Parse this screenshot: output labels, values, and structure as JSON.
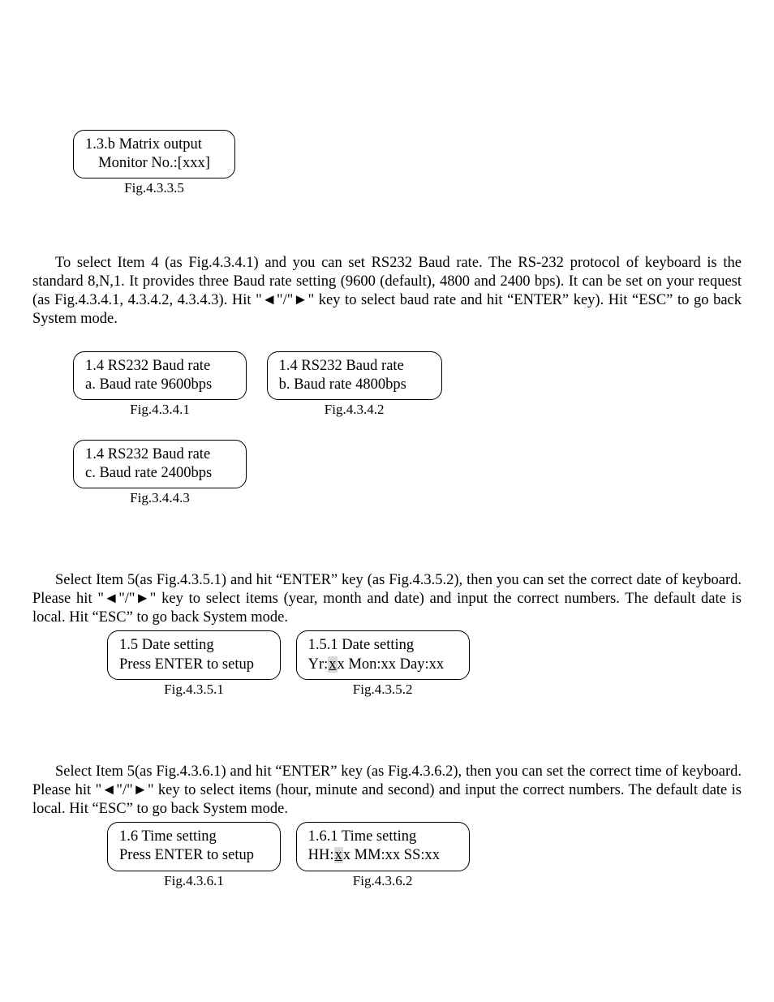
{
  "fig1": {
    "line1": "1.3.b Matrix output",
    "line2": "Monitor No.:[xxx]",
    "caption": "Fig.4.3.3.5"
  },
  "para1": {
    "text_a": "To select Item 4 (as Fig.4.3.4.1) and you can set RS232 Baud rate. The RS-232 protocol of keyboard is the standard 8,N,1. It provides three Baud rate setting (9600 (default), 4800 and 2400 bps). It can be set on your request (as Fig.4.3.4.1, 4.3.4.2, 4.3.4.3). Hit \"◄\"/\"►\" key to select baud rate and hit “ENTER” key). Hit “ESC” to go back System mode."
  },
  "baud": {
    "a": {
      "line1": "1.4 RS232 Baud rate",
      "line2": "a. Baud rate 9600bps",
      "caption": "Fig.4.3.4.1"
    },
    "b": {
      "line1": "1.4 RS232 Baud rate",
      "line2": "b. Baud rate 4800bps",
      "caption": "Fig.4.3.4.2"
    },
    "c": {
      "line1": "1.4 RS232 Baud rate",
      "line2": "c. Baud rate 2400bps",
      "caption": "Fig.3.4.4.3"
    }
  },
  "para2": {
    "text": "Select Item 5(as Fig.4.3.5.1) and hit “ENTER” key (as Fig.4.3.5.2), then you can set the correct date of keyboard. Please hit \"◄\"/\"►\" key to select items (year, month and date) and input the correct numbers. The default date is local. Hit “ESC” to go back System mode."
  },
  "date": {
    "a": {
      "line1": "1.5 Date setting",
      "line2": "Press ENTER to setup",
      "caption": "Fig.4.3.5.1"
    },
    "b": {
      "line1": "1.5.1 Date setting",
      "prefix": "Yr:",
      "hi": "x",
      "suffix": "x Mon:xx Day:xx",
      "caption": "Fig.4.3.5.2"
    }
  },
  "para3": {
    "text": "Select Item 5(as Fig.4.3.6.1) and hit “ENTER” key (as Fig.4.3.6.2), then you can set the correct time of keyboard. Please hit \"◄\"/\"►\" key to select items (hour, minute and second) and input the correct numbers. The default date is local. Hit “ESC” to go back System mode."
  },
  "time": {
    "a": {
      "line1": "1.6 Time setting",
      "line2": "Press ENTER to setup",
      "caption": "Fig.4.3.6.1"
    },
    "b": {
      "line1": "1.6.1 Time setting",
      "prefix": "HH:",
      "hi": "x",
      "suffix": "x MM:xx SS:xx",
      "caption": "Fig.4.3.6.2"
    }
  }
}
